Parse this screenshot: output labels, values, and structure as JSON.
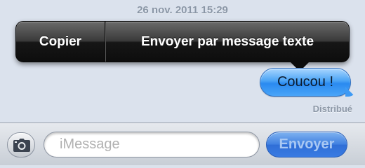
{
  "thread": {
    "timestamp": "26 nov. 2011 15:29",
    "message": "Coucou !",
    "status": "Distribué"
  },
  "context_menu": {
    "copy_label": "Copier",
    "send_sms_label": "Envoyer par message texte"
  },
  "input_bar": {
    "camera_icon": "camera-icon",
    "placeholder": "iMessage",
    "send_label": "Envoyer"
  },
  "colors": {
    "bubble": "#3e9af4",
    "send_button": "#3a7be2",
    "menu": "#161616",
    "background": "#dbe2ed"
  }
}
